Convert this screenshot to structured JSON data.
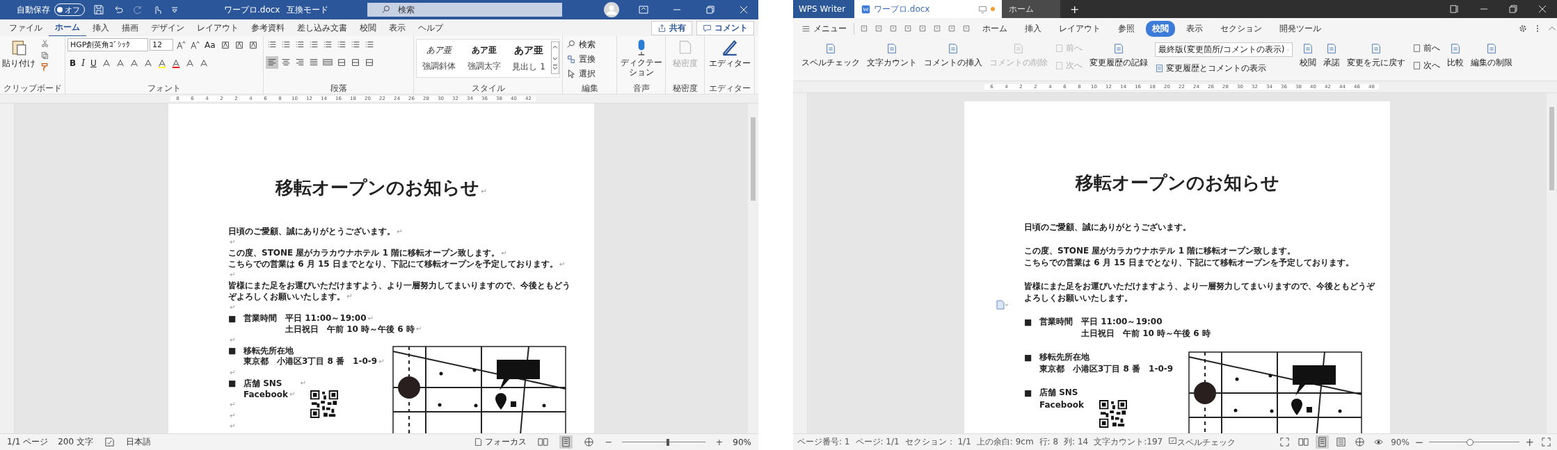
{
  "word": {
    "title_bar": {
      "autosave_label": "自動保存",
      "autosave_toggle": {
        "label": "オフ",
        "on": false
      },
      "filename": "ワープロ.docx",
      "mode": "互換モード",
      "search_placeholder": "検索"
    },
    "tabs": [
      {
        "label": "ファイル",
        "selected": false
      },
      {
        "label": "ホーム",
        "selected": true
      },
      {
        "label": "挿入",
        "selected": false
      },
      {
        "label": "描画",
        "selected": false
      },
      {
        "label": "デザイン",
        "selected": false
      },
      {
        "label": "レイアウト",
        "selected": false
      },
      {
        "label": "参考資料",
        "selected": false
      },
      {
        "label": "差し込み文書",
        "selected": false
      },
      {
        "label": "校閲",
        "selected": false
      },
      {
        "label": "表示",
        "selected": false
      },
      {
        "label": "ヘルプ",
        "selected": false
      }
    ],
    "share_button": "共有",
    "comment_button": "コメント",
    "ribbon": {
      "clipboard": {
        "paste": "貼り付け",
        "label": "クリップボード"
      },
      "font": {
        "font_name": "HGP創英角ｺﾞｼｯｸ",
        "font_size": "12",
        "case_button": "Aa",
        "format_buttons": [
          "B",
          "I",
          "U"
        ],
        "label": "フォント"
      },
      "paragraph": {
        "alignments": [
          {
            "kind": "left",
            "selected": true
          },
          {
            "kind": "center",
            "selected": false
          },
          {
            "kind": "right",
            "selected": false
          },
          {
            "kind": "justify",
            "selected": false
          },
          {
            "kind": "distributed",
            "selected": false
          }
        ],
        "label": "段落"
      },
      "styles": {
        "items": [
          {
            "sample": "あア亜",
            "name": "強調斜体",
            "kind": "italic"
          },
          {
            "sample": "あア亜",
            "name": "強調太字",
            "kind": "bold"
          },
          {
            "sample": "あア亜",
            "name": "見出し 1",
            "kind": "heading"
          }
        ],
        "label": "スタイル"
      },
      "editing": {
        "items": [
          "検索",
          "置換",
          "選択"
        ],
        "label": "編集"
      },
      "voice": {
        "button": "ディクテーション",
        "label": "音声"
      },
      "sensitivity": {
        "button": "秘密度",
        "disabled": true,
        "label": "秘密度"
      },
      "editor": {
        "button": "エディター",
        "label": "エディター"
      }
    },
    "ruler": [
      "8",
      "6",
      "4",
      "2",
      "2",
      "4",
      "6",
      "8",
      "10",
      "12",
      "14",
      "16",
      "18",
      "20",
      "22",
      "24",
      "26",
      "28",
      "30",
      "32",
      "34",
      "36",
      "38",
      "40",
      "42"
    ],
    "document": {
      "para_mark": "↵",
      "heading": "移転オープンのお知らせ",
      "blocks": [
        {
          "kind": "para",
          "lines": [
            "日頃のご愛顧、誠にありがとうございます。"
          ]
        },
        {
          "kind": "blank"
        },
        {
          "kind": "para",
          "lines": [
            "この度、STONE 屋がカラカウナホテル 1 階に移転オープン致します。"
          ]
        },
        {
          "kind": "para",
          "lines": [
            "こちらでの営業は 6 月 15 日までとなり、下記にて移転オープンを予定しております。"
          ]
        },
        {
          "kind": "blank"
        },
        {
          "kind": "para",
          "lines": [
            "皆様にまた足をお運びいただけますよう、より一層努力してまいりますので、今後ともどう",
            "ぞよろしくお願いいたします。"
          ]
        },
        {
          "kind": "blank"
        },
        {
          "kind": "inline_item",
          "bullet": "■",
          "label": "営業時間",
          "lines": [
            "平日 11:00～19:00",
            "土日祝日　午前 10 時～午後 6 時"
          ]
        },
        {
          "kind": "blank"
        },
        {
          "kind": "item",
          "bullet": "■",
          "label": "移転先所在地",
          "lines": [
            "東京都　小港区3丁目 8 番　1-0-9"
          ]
        },
        {
          "kind": "blank"
        },
        {
          "kind": "item",
          "bullet": "■",
          "label": "店舗 SNS",
          "lines": [
            "Facebook"
          ],
          "qr": true
        },
        {
          "kind": "blank"
        },
        {
          "kind": "blank"
        },
        {
          "kind": "blank"
        }
      ]
    },
    "status_bar": {
      "items": [
        "1/1 ページ",
        "200 文字"
      ],
      "language": "日本語",
      "focus": "フォーカス",
      "zoom_out": "−",
      "zoom_in": "+",
      "zoom": "90%",
      "zoom_slider": {
        "level": 0.55
      }
    }
  },
  "wps": {
    "app_tab": "WPS Writer",
    "doc_tabs": [
      {
        "label": "ワープロ.docx",
        "selected": true,
        "unsaved": true
      },
      {
        "label": "ホーム",
        "selected": false,
        "unsaved": false
      }
    ],
    "new_tab": "+",
    "menu_button": "メニュー",
    "tabs": [
      {
        "label": "ホーム",
        "selected": false
      },
      {
        "label": "挿入",
        "selected": false
      },
      {
        "label": "レイアウト",
        "selected": false
      },
      {
        "label": "参照",
        "selected": false
      },
      {
        "label": "校閲",
        "selected": true
      },
      {
        "label": "表示",
        "selected": false
      },
      {
        "label": "セクション",
        "selected": false
      },
      {
        "label": "開発ツール",
        "selected": false
      }
    ],
    "ribbon": [
      {
        "kind": "big",
        "label": "スペルチェック",
        "disabled": false
      },
      {
        "kind": "big",
        "label": "文字カウント",
        "disabled": false
      },
      {
        "kind": "big",
        "label": "コメントの挿入",
        "disabled": false
      },
      {
        "kind": "big",
        "label": "コメントの削除",
        "disabled": true
      },
      {
        "kind": "pair",
        "rows": [
          {
            "label": "前へ",
            "disabled": true
          },
          {
            "label": "次へ",
            "disabled": true
          }
        ]
      },
      {
        "kind": "big",
        "label": "変更履歴の記録",
        "disabled": false
      },
      {
        "kind": "select",
        "value": "最終版(変更箇所/コメントの表示)",
        "option_label": "変更履歴とコメントの表示"
      },
      {
        "kind": "big",
        "label": "校閲",
        "disabled": false
      },
      {
        "kind": "big",
        "label": "承諾",
        "disabled": false
      },
      {
        "kind": "big",
        "label": "変更を元に戻す",
        "disabled": false
      },
      {
        "kind": "pair",
        "rows": [
          {
            "label": "前へ",
            "disabled": false
          },
          {
            "label": "次へ",
            "disabled": false
          }
        ]
      },
      {
        "kind": "big",
        "label": "比較",
        "disabled": false
      },
      {
        "kind": "big",
        "label": "編集の制限",
        "disabled": false
      }
    ],
    "ruler": [
      "6",
      "4",
      "2",
      "2",
      "4",
      "6",
      "8",
      "10",
      "12",
      "14",
      "16",
      "18",
      "20",
      "22",
      "24",
      "26",
      "28",
      "30",
      "32",
      "34",
      "36",
      "38",
      "40",
      "42",
      "44",
      "46",
      "48"
    ],
    "document": {
      "heading": "移転オープンのお知らせ",
      "blocks": [
        {
          "kind": "para",
          "lines": [
            "日頃のご愛顧、誠にありがとうございます。"
          ]
        },
        {
          "kind": "blank"
        },
        {
          "kind": "para",
          "lines": [
            "この度、STONE 屋がカラカウナホテル 1 階に移転オープン致します。"
          ]
        },
        {
          "kind": "para",
          "lines": [
            "こちらでの営業は 6 月 15 日までとなり、下記にて移転オープンを予定しております。"
          ]
        },
        {
          "kind": "blank"
        },
        {
          "kind": "para",
          "lines": [
            "皆様にまた足をお運びいただけますよう、より一層努力してまいりますので、今後ともどうぞ",
            "よろしくお願いいたします。"
          ]
        },
        {
          "kind": "blank"
        },
        {
          "kind": "inline_item",
          "bullet": "■",
          "label": "営業時間",
          "lines": [
            "平日 11:00～19:00",
            "土日祝日　午前 10 時～午後 6 時"
          ]
        },
        {
          "kind": "blank"
        },
        {
          "kind": "item",
          "bullet": "■",
          "label": "移転先所在地",
          "lines": [
            "東京都　小港区3丁目 8 番　1-0-9"
          ]
        },
        {
          "kind": "blank"
        },
        {
          "kind": "item",
          "bullet": "■",
          "label": "店舗 SNS",
          "lines": [
            "Facebook"
          ],
          "qr": true
        }
      ]
    },
    "status_bar": {
      "items": [
        "ページ番号: 1",
        "ページ: 1/1",
        "セクション： 1/1",
        "上の余白: 9cm",
        "行: 8",
        "列: 14",
        "文字カウント:197"
      ],
      "spell": "スペルチェック",
      "zoom": "90%",
      "zoom_out": "−",
      "zoom_in": "+",
      "zoom_slider": {
        "level": 0.45
      }
    }
  }
}
